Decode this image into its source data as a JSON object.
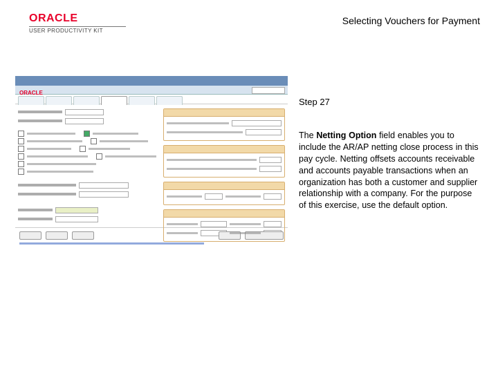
{
  "header": {
    "logo_brand": "ORACLE",
    "logo_sub": "USER PRODUCTIVITY KIT",
    "title": "Selecting Vouchers for Payment"
  },
  "panel": {
    "step": "Step 27",
    "description_pre": "The ",
    "description_bold": "Netting Option",
    "description_post": " field enables you to include the AR/AP netting close process in this pay cycle. Netting offsets accounts receivable and accounts payable transactions when an organization has both a customer and supplier relationship with a company. For the purpose of this exercise, use the default option."
  }
}
